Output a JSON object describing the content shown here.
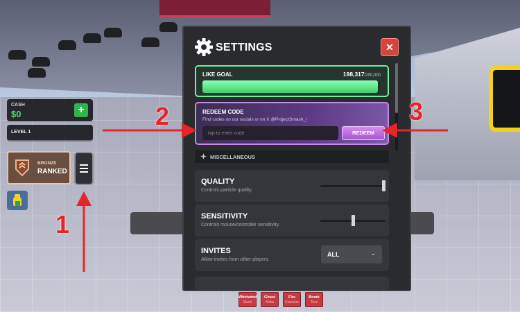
{
  "hud": {
    "cash_label": "CASH",
    "cash_value": "$0",
    "add_cash_symbol": "+",
    "level_label": "LEVEL 1",
    "rank_tier": "BRONZE",
    "rank_name": "RANKED"
  },
  "settings": {
    "title": "SETTINGS",
    "close_symbol": "✕",
    "like_goal": {
      "label": "LIKE GOAL",
      "current": "198,317",
      "target": "/200,000",
      "progress_fraction": 0.99
    },
    "redeem": {
      "label": "REDEEM CODE",
      "hint": "Find codes on our socials or on X @ProjectSmash_!",
      "input_placeholder": "tap to enter code",
      "button_label": "REDEEM"
    },
    "misc_header": "MISCELLANEOUS",
    "rows": {
      "quality": {
        "title": "QUALITY",
        "desc": "Controls particle quality.",
        "level_fraction": 1.0
      },
      "sensitivity": {
        "title": "SENSITIVITY",
        "desc": "Controls mouse/controller sensitivity.",
        "level_fraction": 0.5
      },
      "invites": {
        "title": "INVITES",
        "desc": "Allow invites from other players.",
        "value": "ALL"
      }
    }
  },
  "bottom_items": [
    {
      "title": "Whirlwind",
      "sub": "Slash"
    },
    {
      "title": "Ghost",
      "sub": "Strike"
    },
    {
      "title": "Fire",
      "sub": "Crackers"
    },
    {
      "title": "Bomb",
      "sub": "Toss"
    }
  ],
  "annotations": [
    "1",
    "2",
    "3"
  ],
  "colors": {
    "annotation_red": "#e4252b",
    "like_green": "#6ef29b",
    "redeem_purple": "#c58be8",
    "close_red": "#d7443c",
    "cash_green": "#48e06a"
  }
}
